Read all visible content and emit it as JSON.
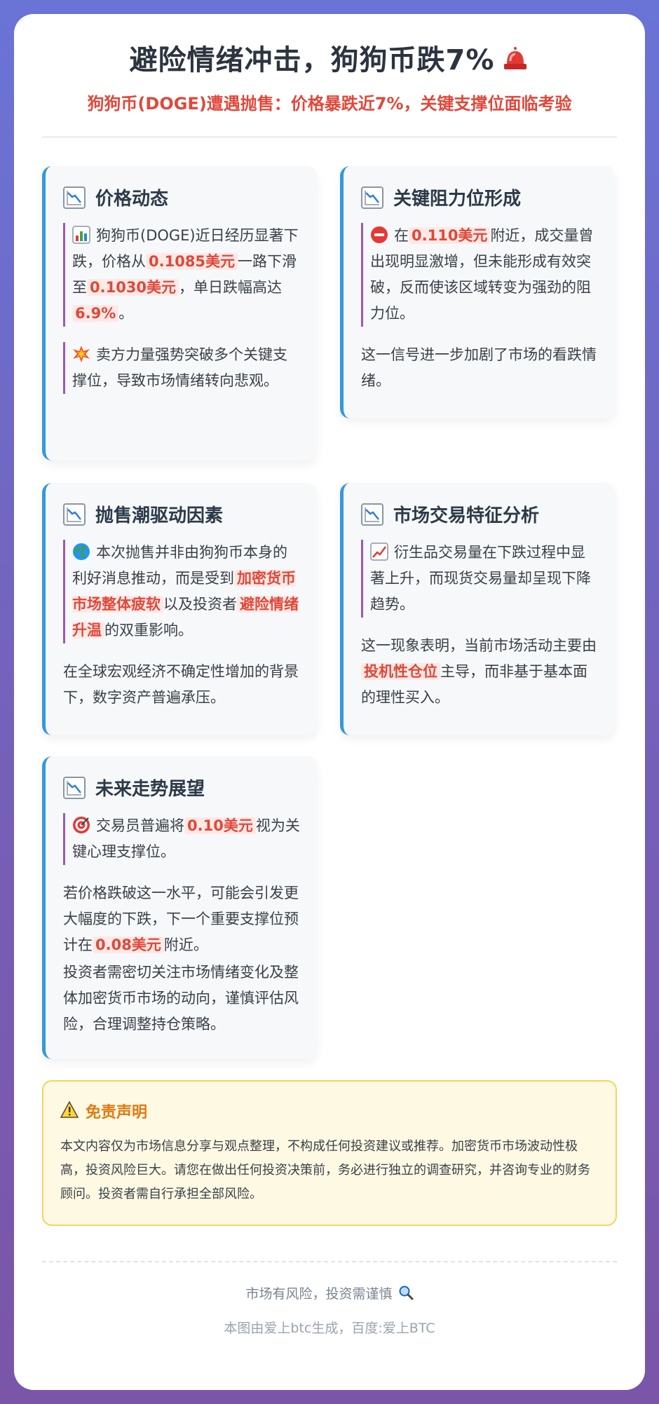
{
  "header": {
    "title": "避险情绪冲击，狗狗币跌7%",
    "subtitle": "狗狗币(DOGE)遭遇抛售：价格暴跌近7%，关键支撑位面临考验"
  },
  "sections": {
    "price": {
      "title": "价格动态",
      "q1": {
        "t1": "狗狗币(DOGE)近日经历显著下跌，价格从",
        "h1": "0.1085美元",
        "t2": "一路下滑至",
        "h2": "0.1030美元",
        "t3": "，单日跌幅高达",
        "h3": "6.9%",
        "t4": "。"
      },
      "q2": "卖方力量强势突破多个关键支撑位，导致市场情绪转向悲观。"
    },
    "resistance": {
      "title": "关键阻力位形成",
      "q1": {
        "t1": "在",
        "h1": "0.110美元",
        "t2": "附近，成交量曾出现明显激增，但未能形成有效突破，反而使该区域转变为强劲的阻力位。"
      },
      "p1": "这一信号进一步加剧了市场的看跌情绪。"
    },
    "drivers": {
      "title": "抛售潮驱动因素",
      "q1": {
        "t1": "本次抛售并非由狗狗币本身的利好消息推动，而是受到",
        "h1": "加密货币市场整体疲软",
        "t2": "以及投资者",
        "h2": "避险情绪升温",
        "t3": "的双重影响。"
      },
      "p1": "在全球宏观经济不确定性增加的背景下，数字资产普遍承压。"
    },
    "trading": {
      "title": "市场交易特征分析",
      "q1": "衍生品交易量在下跌过程中显著上升，而现货交易量却呈现下降趋势。",
      "p1": {
        "t1": "这一现象表明，当前市场活动主要由",
        "h1": "投机性仓位",
        "t2": "主导，而非基于基本面的理性买入。"
      }
    },
    "outlook": {
      "title": "未来走势展望",
      "q1": {
        "t1": "交易员普遍将",
        "h1": "0.10美元",
        "t2": "视为关键心理支撑位。"
      },
      "p1": {
        "t1": "若价格跌破这一水平，可能会引发更大幅度的下跌，下一个重要支撑位预计在",
        "h1": "0.08美元",
        "t2": "附近。"
      },
      "p2": "投资者需密切关注市场情绪变化及整体加密货币市场的动向，谨慎评估风险，合理调整持仓策略。"
    }
  },
  "disclaimer": {
    "title": "免责声明",
    "text": "本文内容仅为市场信息分享与观点整理，不构成任何投资建议或推荐。加密货币市场波动性极高，投资风险巨大。请您在做出任何投资决策前，务必进行独立的调查研究，并咨询专业的财务顾问。投资者需自行承担全部风险。"
  },
  "footer": {
    "line1": "市场有风险，投资需谨慎",
    "line2": "本图由爱上btc生成，百度:爱上BTC"
  },
  "colors": {
    "accent_blue": "#3498db",
    "accent_purple": "#9b59b6",
    "highlight_red": "#e0483a",
    "warning_orange": "#e07a10"
  },
  "icons": [
    "siren-icon",
    "chart-decreasing-icon",
    "bar-chart-icon",
    "collision-icon",
    "no-entry-icon",
    "globe-icon",
    "chart-increasing-icon",
    "target-icon",
    "warning-icon",
    "magnifier-icon"
  ]
}
